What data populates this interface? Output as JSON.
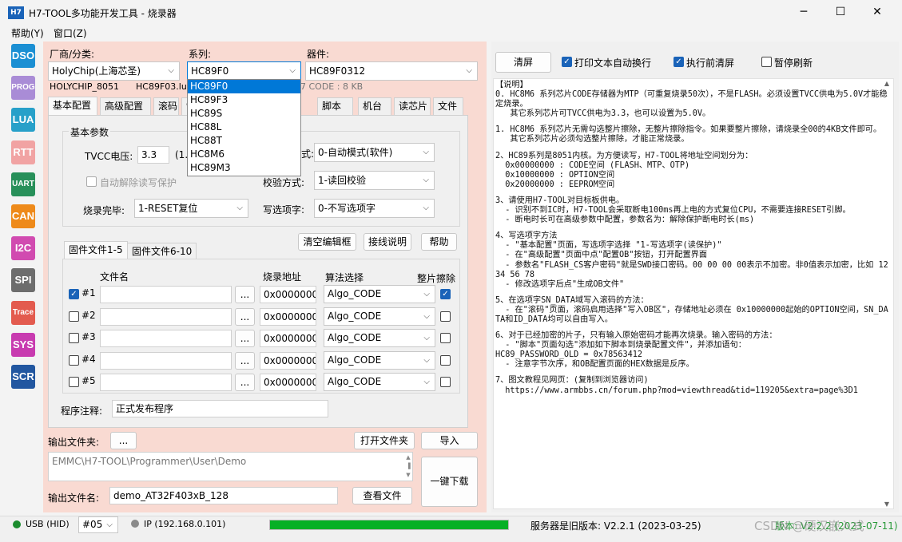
{
  "window": {
    "app_icon": "H7",
    "title": "H7-TOOL多功能开发工具 - 烧录器",
    "minimize": "─",
    "maximize": "☐",
    "close": "✕"
  },
  "menu": [
    "帮助(Y)",
    "窗口(Z)"
  ],
  "tools": [
    {
      "label": "DSO",
      "color": "#1b8fd3"
    },
    {
      "label": "PROG",
      "color": "#a98cd6"
    },
    {
      "label": "LUA",
      "color": "#27a0c9"
    },
    {
      "label": "RTT",
      "color": "#f1a3a3"
    },
    {
      "label": "UART",
      "color": "#28905a"
    },
    {
      "label": "CAN",
      "color": "#ee8a1a"
    },
    {
      "label": "I2C",
      "color": "#d14bb0"
    },
    {
      "label": "SPI",
      "color": "#6d6d6d"
    },
    {
      "label": "Trace",
      "color": "#e35b4f"
    },
    {
      "label": "SYS",
      "color": "#c83bb0"
    },
    {
      "label": "SCR",
      "color": "#2257a0"
    }
  ],
  "header": {
    "vendor_label": "厂商/分类:",
    "vendor_value": "HolyChip(上海芯圣)",
    "series_label": "系列:",
    "series_value": "HC89F0",
    "device_label": "器件:",
    "device_value": "HC89F0312",
    "info_vendor": "HOLYCHIP_8051",
    "info_file": "HC89F03.lua",
    "info_code": "7 CODE : 8 KB"
  },
  "series_dropdown": [
    "HC89F0",
    "HC89F3",
    "HC89S",
    "HC88L",
    "HC88T",
    "HC8M6",
    "HC89M3"
  ],
  "tabs": [
    "基本配置",
    "高级配置",
    "滚码",
    "制",
    "脚本",
    "机台",
    "读芯片",
    "文件"
  ],
  "basic": {
    "group_title": "基本参数",
    "tvcc_label": "TVCC电压:",
    "tvcc_value": "3.3",
    "tvcc_unit": "(1.",
    "mode_label": "式:",
    "mode_value": "0-自动模式(软件)",
    "auto_unlock_label": "自动解除读写保护",
    "verify_label": "校验方式:",
    "verify_value": "1-读回校验",
    "after_label": "烧录完毕:",
    "after_value": "1-RESET复位",
    "option_label": "写选项字:",
    "option_value": "0-不写选项字"
  },
  "buttons": {
    "clear_editor": "清空编辑框",
    "wiring": "接线说明",
    "help": "帮助"
  },
  "file_tabs": [
    "固件文件1-5",
    "固件文件6-10"
  ],
  "file_table": {
    "headers": [
      "文件名",
      "烧录地址",
      "算法选择",
      "整片擦除"
    ],
    "rows": [
      {
        "num": "#1",
        "checked": true,
        "file": "",
        "browse": "...",
        "addr": "0x00000000",
        "algo": "Algo_CODE",
        "erase": true
      },
      {
        "num": "#2",
        "checked": false,
        "file": "",
        "browse": "...",
        "addr": "0x00000000",
        "algo": "Algo_CODE",
        "erase": false
      },
      {
        "num": "#3",
        "checked": false,
        "file": "",
        "browse": "...",
        "addr": "0x00000000",
        "algo": "Algo_CODE",
        "erase": false
      },
      {
        "num": "#4",
        "checked": false,
        "file": "",
        "browse": "...",
        "addr": "0x00000000",
        "algo": "Algo_CODE",
        "erase": false
      },
      {
        "num": "#5",
        "checked": false,
        "file": "",
        "browse": "...",
        "addr": "0x00000000",
        "algo": "Algo_CODE",
        "erase": false
      }
    ]
  },
  "comment_label": "程序注释:",
  "comment_value": "正式发布程序",
  "output": {
    "folder_label": "输出文件夹:",
    "folder_button": "...",
    "open_folder": "打开文件夹",
    "import": "导入",
    "path": "EMMC\\H7-TOOL\\Programmer\\User\\Demo",
    "one_key": "一键下载",
    "filename_label": "输出文件名:",
    "filename_value": "demo_AT32F403xB_128",
    "view_file": "查看文件"
  },
  "right": {
    "clear_button": "清屏",
    "auto_wrap_label": "打印文本自动换行",
    "auto_wrap": true,
    "clear_before_label": "执行前清屏",
    "clear_before": true,
    "pause_label": "暂停刷新",
    "pause": false,
    "text_lines": [
      "【说明】",
      "0. HC8M6 系列芯片CODE存储器为MTP（可重复烧录50次），不是FLASH。必须设置TVCC供电为5.0V才能稳定烧录。",
      "   其它系列芯片可TVCC供电为3.3，也可以设置为5.0V。",
      "",
      "1. HC8M6 系列芯片无需勾选整片擦除，无整片擦除指令。如果要整片擦除，请烧录全00的4KB文件即可。",
      "   其它系列芯片必须勾选整片擦除，才能正常烧录。",
      "",
      "2、HC89系列是8051内核。为方便读写，H7-TOOL将地址空间划分为：",
      "  0x00000000 : CODE空间 (FLASH、MTP、OTP)",
      "  0x10000000 : OPTION空间",
      "  0x20000000 : EEPROM空间",
      "",
      "3、请使用H7-TOOL对目标板供电。",
      "  - 识别不到IC时，H7-TOOL会采取断电100ms再上电的方式复位CPU，不需要连接RESET引脚。",
      "  - 断电时长可在高级参数中配置，参数名为：解除保护断电时长(ms)",
      "",
      "4、写选项字方法",
      "  - \"基本配置\"页面，写选项字选择 \"1-写选项字(读保护)\"",
      "  - 在\"高级配置\"页面中点\"配置OB\"按钮，打开配置界面",
      "  - 参数名\"FLASH_CS客户密码\"就是SWD接口密码。00 00 00 00表示不加密。非0值表示加密，比如 12 34 56 78",
      "  - 修改选项字后点\"生成OB文件\"",
      "",
      "5、在选项字SN_DATA域写入滚码的方法：",
      "  - 在\"滚码\"页面，滚码启用选择\"写入OB区\"，存储地址必须在 0x10000000起始的OPTION空间，SN_DATA和ID_DATA均可以自由写入。",
      "",
      "6、对于已经加密的片子，只有输入原始密码才能再次烧录。输入密码的方法：",
      "  - \"脚本\"页面勾选\"添加如下脚本到烧录配置文件\"，并添加语句：",
      "HC89_PASSWORD_OLD = 0x78563412",
      "  - 注意字节次序，和OB配置页面的HEX数据是反序。",
      "",
      "7、图文教程见网页：(复制到浏览器访问)",
      "  https://www.armbbs.cn/forum.php?mod=viewthread&tid=119205&extra=page%3D1"
    ]
  },
  "status": {
    "usb": "USB (HID)",
    "port": "#05",
    "ip": "IP (192.168.0.101)",
    "progress": 1.0,
    "server": "服务器是旧版本: V2.2.1 (2023-03-25)",
    "version": "版本: V2.2.2 (2023-07-11)",
    "watermark": "CSDN @硬汉嵌入式"
  }
}
